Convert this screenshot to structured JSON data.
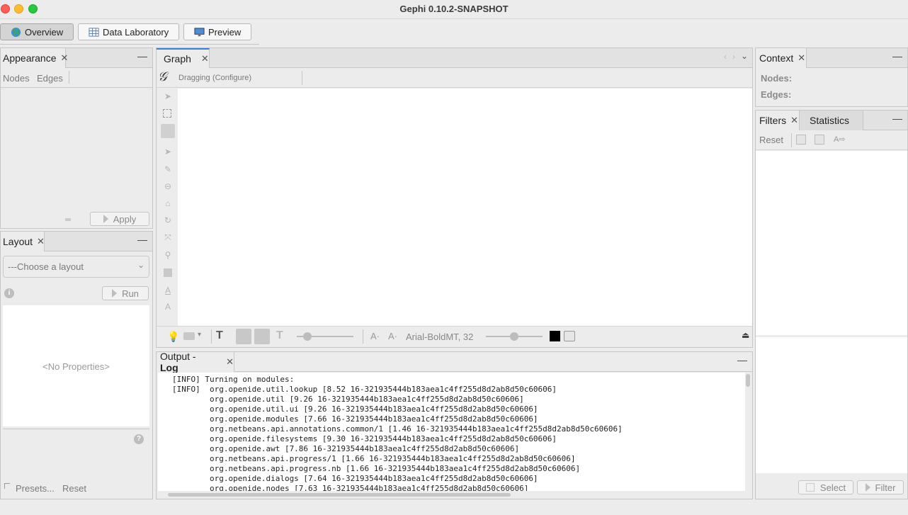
{
  "window": {
    "title": "Gephi 0.10.2-SNAPSHOT"
  },
  "workspace_tabs": [
    {
      "label": "Overview",
      "icon": "globe-icon",
      "active": true
    },
    {
      "label": "Data Laboratory",
      "icon": "table-icon",
      "active": false
    },
    {
      "label": "Preview",
      "icon": "monitor-icon",
      "active": false
    }
  ],
  "appearance": {
    "tab_label": "Appearance",
    "subtabs": [
      "Nodes",
      "Edges"
    ],
    "apply_label": "Apply"
  },
  "layout_panel": {
    "tab_label": "Layout",
    "select_placeholder": "---Choose a layout",
    "run_label": "Run",
    "no_properties": "<No Properties>",
    "presets_label": "Presets...",
    "reset_label": "Reset"
  },
  "graph": {
    "tab_label": "Graph",
    "mode_label": "Dragging",
    "configure_label": "(Configure)",
    "font_label": "Arial-BoldMT, 32",
    "color_swatch": "#000000"
  },
  "output": {
    "tab_label_prefix": "Output - ",
    "tab_label_bold": "Log",
    "lines": [
      "[INFO] Turning on modules:",
      "[INFO]  org.openide.util.lookup [8.52 16-321935444b183aea1c4ff255d8d2ab8d50c60606]",
      "        org.openide.util [9.26 16-321935444b183aea1c4ff255d8d2ab8d50c60606]",
      "        org.openide.util.ui [9.26 16-321935444b183aea1c4ff255d8d2ab8d50c60606]",
      "        org.openide.modules [7.66 16-321935444b183aea1c4ff255d8d2ab8d50c60606]",
      "        org.netbeans.api.annotations.common/1 [1.46 16-321935444b183aea1c4ff255d8d2ab8d50c60606]",
      "        org.openide.filesystems [9.30 16-321935444b183aea1c4ff255d8d2ab8d50c60606]",
      "        org.openide.awt [7.86 16-321935444b183aea1c4ff255d8d2ab8d50c60606]",
      "        org.netbeans.api.progress/1 [1.66 16-321935444b183aea1c4ff255d8d2ab8d50c60606]",
      "        org.netbeans.api.progress.nb [1.66 16-321935444b183aea1c4ff255d8d2ab8d50c60606]",
      "        org.openide.dialogs [7.64 16-321935444b183aea1c4ff255d8d2ab8d50c60606]",
      "        org.openide.nodes [7.63 16-321935444b183aea1c4ff255d8d2ab8d50c60606]"
    ]
  },
  "context": {
    "tab_label": "Context",
    "nodes_label": "Nodes:",
    "edges_label": "Edges:"
  },
  "filters": {
    "tab_label": "Filters",
    "statistics_tab_label": "Statistics",
    "reset_label": "Reset",
    "select_label": "Select",
    "filter_label": "Filter"
  }
}
